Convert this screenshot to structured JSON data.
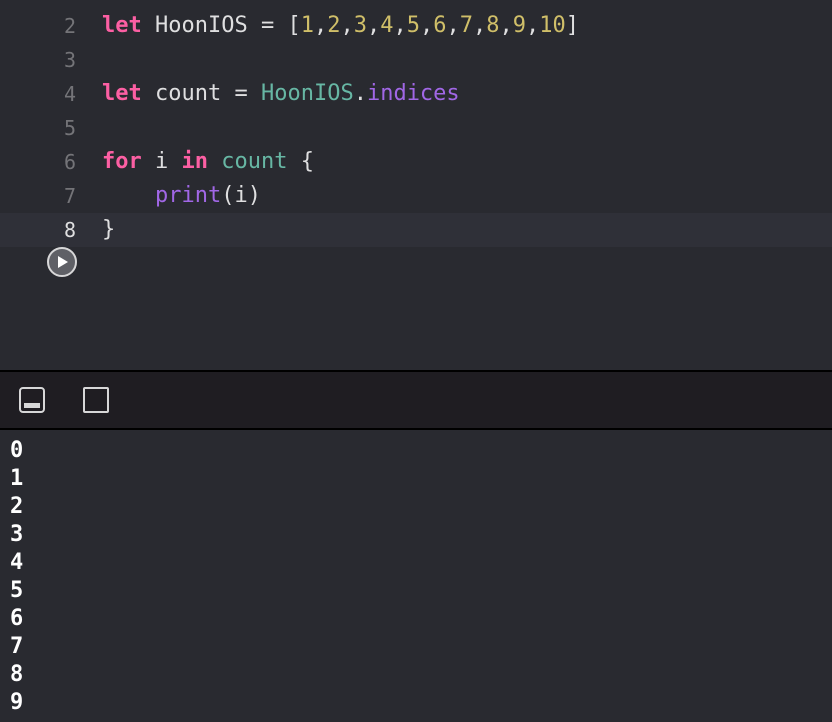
{
  "editor": {
    "lines": [
      {
        "number": "2",
        "tokens": {
          "kw": "let",
          "name": "HoonIOS",
          "eq": "=",
          "open": "[",
          "n1": "1",
          "n2": "2",
          "n3": "3",
          "n4": "4",
          "n5": "5",
          "n6": "6",
          "n7": "7",
          "n8": "8",
          "n9": "9",
          "n10": "10",
          "close": "]"
        }
      },
      {
        "number": "3"
      },
      {
        "number": "4",
        "tokens": {
          "kw": "let",
          "name": "count",
          "eq": "=",
          "ref": "HoonIOS",
          "dot": ".",
          "prop": "indices"
        }
      },
      {
        "number": "5"
      },
      {
        "number": "6",
        "tokens": {
          "kw1": "for",
          "var": "i",
          "kw2": "in",
          "ref": "count",
          "brace": "{"
        }
      },
      {
        "number": "7",
        "tokens": {
          "fn": "print",
          "open": "(",
          "arg": "i",
          "close": ")"
        }
      },
      {
        "number": "8",
        "tokens": {
          "brace": "}"
        }
      }
    ],
    "run_icon": "play-icon"
  },
  "toolbar": {
    "icons": [
      "hide-debug-area-icon",
      "show-console-icon"
    ]
  },
  "console": {
    "output": [
      "0",
      "1",
      "2",
      "3",
      "4",
      "5",
      "6",
      "7",
      "8",
      "9"
    ]
  },
  "colors": {
    "background": "#292a30",
    "keyword": "#fc5fa3",
    "number": "#d0bf69",
    "type_identifier": "#67b7a4",
    "function": "#a167e6",
    "plain": "#dfdfe0"
  }
}
